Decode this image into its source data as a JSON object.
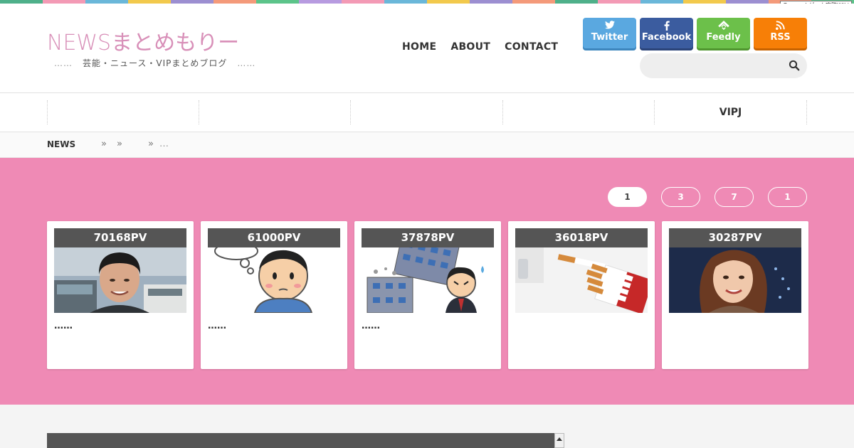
{
  "stripe_colors": [
    "#4fb08a",
    "#f39ab5",
    "#6ab7d9",
    "#f2c94c",
    "#9c8fd1",
    "#f49a7a",
    "#5cc48a",
    "#b79be0",
    "#f39ab5",
    "#6ab7d9",
    "#f2c94c",
    "#9c8fd1",
    "#f49a7a",
    "#4fb08a",
    "#f39ab5",
    "#6ab7d9",
    "#f2c94c",
    "#9c8fd1",
    "#f49a7a",
    "#5cc48a"
  ],
  "gamerch_label": "Gamerchゲーム攻略Wiki",
  "site": {
    "logo": "NEWSまとめもりー",
    "tagline": "芸能・ニュース・VIPまとめブログ",
    "tagline_dots": "……"
  },
  "nav": {
    "home": "HOME",
    "about": "ABOUT",
    "contact": "CONTACT"
  },
  "social": {
    "twitter": "Twitter",
    "facebook": "Facebook",
    "feedly": "Feedly",
    "rss": "RSS"
  },
  "search": {
    "placeholder": ""
  },
  "categories": [
    "",
    "",
    "",
    "",
    "VIPJ"
  ],
  "breadcrumb": {
    "home": "NEWS",
    "sep": "»",
    "ellipsis": "…"
  },
  "ranking": {
    "tabs": [
      "1",
      "3",
      "7",
      "1"
    ],
    "cards": [
      {
        "pv": "70168PV",
        "title": "……"
      },
      {
        "pv": "61000PV",
        "title": "……"
      },
      {
        "pv": "37878PV",
        "title": "……"
      },
      {
        "pv": "36018PV",
        "title": ""
      },
      {
        "pv": "30287PV",
        "title": ""
      }
    ]
  },
  "colors": {
    "pink_bg": "#ef8ab5",
    "logo": "#d88fb8",
    "twitter": "#5aa8e0",
    "facebook": "#3b5c9f",
    "feedly": "#6cc04a",
    "rss": "#f77f07"
  }
}
